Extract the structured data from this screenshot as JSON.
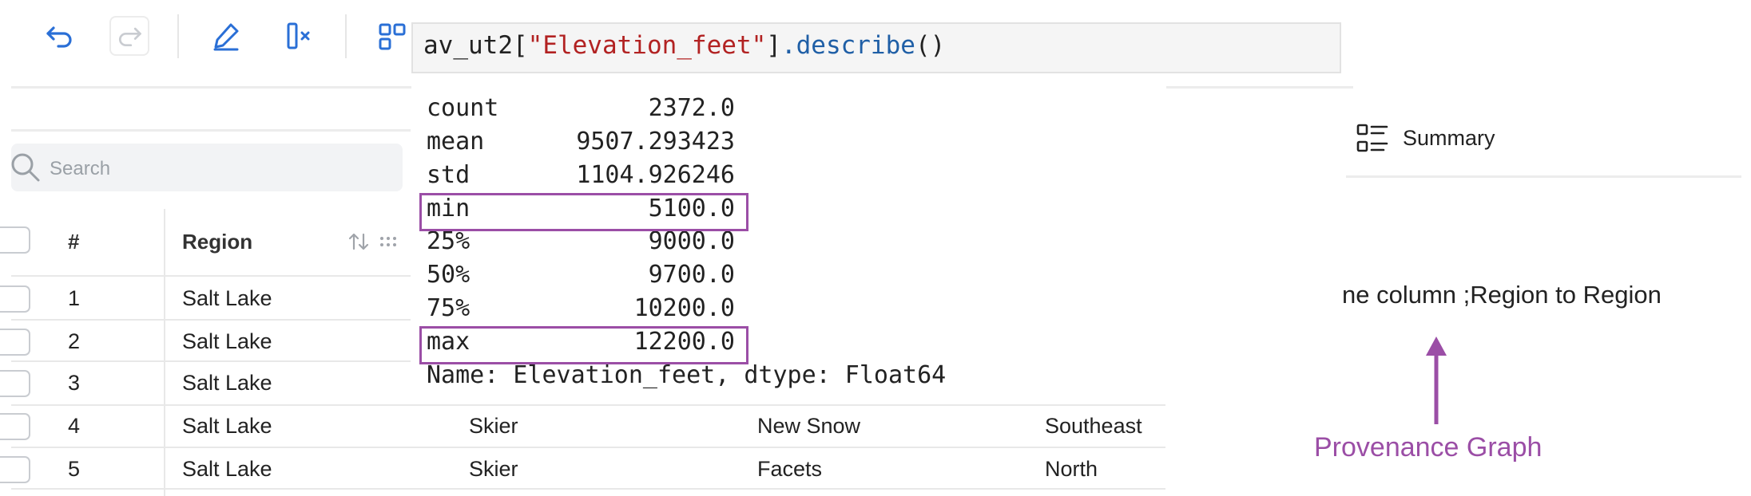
{
  "toolbar": {
    "undo_icon": "undo-icon",
    "redo_icon": "redo-icon",
    "edit_icon": "pencil-icon",
    "delete_column_icon": "delete-column-icon",
    "partial_icon_label": "88"
  },
  "search": {
    "placeholder": "Search"
  },
  "table": {
    "headers": {
      "index": "#",
      "region": "Region"
    },
    "rows": [
      {
        "index": "1",
        "region": "Salt Lake",
        "c3": "",
        "c4": "",
        "c5": ""
      },
      {
        "index": "2",
        "region": "Salt Lake",
        "c3": "",
        "c4": "",
        "c5": ""
      },
      {
        "index": "3",
        "region": "Salt Lake",
        "c3": "",
        "c4": "",
        "c5": ""
      },
      {
        "index": "4",
        "region": "Salt Lake",
        "c3": "Skier",
        "c4": "New Snow",
        "c5": "Southeast"
      },
      {
        "index": "5",
        "region": "Salt Lake",
        "c3": "Skier",
        "c4": "Facets",
        "c5": "North"
      }
    ]
  },
  "code_cell": {
    "var": "av_ut2",
    "open": "[",
    "string": "\"Elevation_feet\"",
    "close": "]",
    "method": ".describe",
    "parens": "()",
    "colors": {
      "string": "#b22222",
      "method": "#1f5fa6",
      "default": "#222222"
    }
  },
  "output": {
    "stats": [
      {
        "label": "count",
        "value": "2372.0"
      },
      {
        "label": "mean",
        "value": "9507.293423"
      },
      {
        "label": "std",
        "value": "1104.926246"
      },
      {
        "label": "min",
        "value": "5100.0"
      },
      {
        "label": "25%",
        "value": "9000.0"
      },
      {
        "label": "50%",
        "value": "9700.0"
      },
      {
        "label": "75%",
        "value": "10200.0"
      },
      {
        "label": "max",
        "value": "12200.0"
      }
    ],
    "footer": "Name: Elevation_feet, dtype: Float64"
  },
  "right_panel": {
    "summary_tab": "Summary",
    "provenance_text": "ne column ;Region to Region",
    "provenance_label": "Provenance Graph",
    "accent": "#9b4ea6"
  }
}
